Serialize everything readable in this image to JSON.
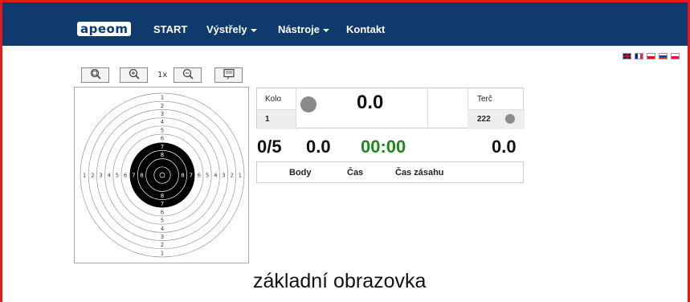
{
  "nav": {
    "logo": "apeom",
    "items": [
      {
        "label": "START",
        "has_dropdown": false
      },
      {
        "label": "Výstřely",
        "has_dropdown": true
      },
      {
        "label": "Nástroje",
        "has_dropdown": true
      },
      {
        "label": "Kontakt",
        "has_dropdown": false
      }
    ],
    "background_color": "#0e3a6e"
  },
  "languages": [
    "en-flag-icon",
    "fr-flag-icon",
    "cz-flag-icon",
    "ru-flag-icon",
    "pl-flag-icon"
  ],
  "toolbar": {
    "buttons": [
      "zoom-fit-icon",
      "zoom-in-icon",
      "zoom-out-icon",
      "image-icon"
    ],
    "zoom_level": "1x"
  },
  "target": {
    "ring_labels": [
      "1",
      "2",
      "3",
      "4",
      "5",
      "6",
      "7",
      "8"
    ]
  },
  "score": {
    "kolo_label": "Kolo",
    "kolo_value": "1",
    "series_score": "0.0",
    "terc_label": "Terč",
    "terc_value": "222"
  },
  "summary": {
    "shots": "0/5",
    "score": "0.0",
    "time": "00:00",
    "total": "0.0",
    "time_color": "#1a8a1a"
  },
  "results": {
    "columns": [
      "Body",
      "Čas",
      "Čas zásahu"
    ]
  },
  "caption": "základní obrazovka",
  "accent_border_color": "#e3191c"
}
